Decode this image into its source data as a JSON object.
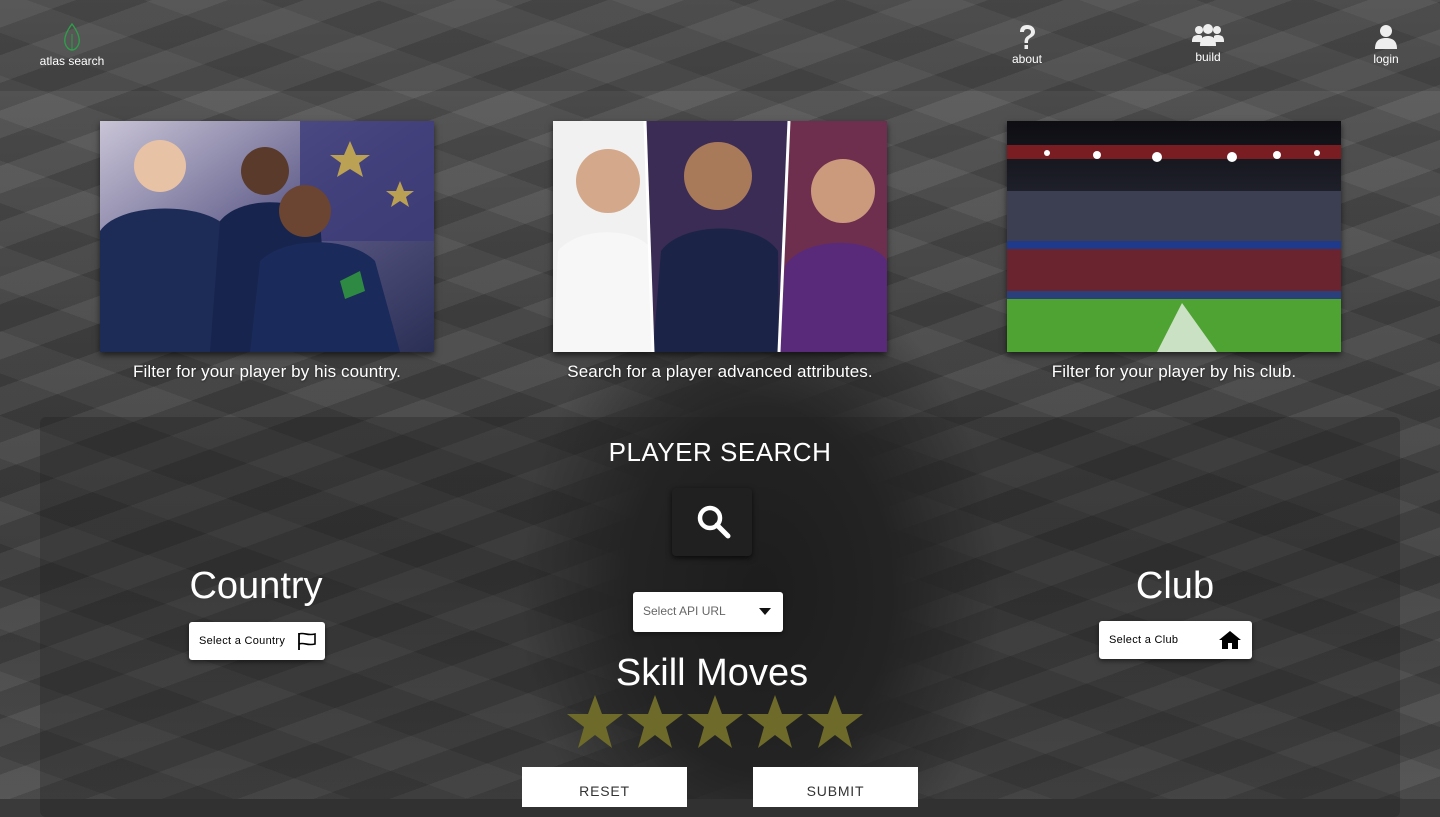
{
  "header": {
    "brand": "atlas search",
    "nav": [
      {
        "label": "about",
        "icon": "question-icon"
      },
      {
        "label": "build",
        "icon": "users-icon"
      },
      {
        "label": "login",
        "icon": "user-icon"
      }
    ]
  },
  "features": [
    {
      "caption": "Filter for your player by his country."
    },
    {
      "caption": "Search for a player advanced attributes."
    },
    {
      "caption": "Filter for your player by his club."
    }
  ],
  "search": {
    "title": "PLAYER SEARCH",
    "country": {
      "title": "Country",
      "placeholder": "Select a Country"
    },
    "api": {
      "placeholder": "Select API URL"
    },
    "club": {
      "title": "Club",
      "placeholder": "Select a Club"
    },
    "skill": {
      "title": "Skill Moves",
      "max_stars": 5
    },
    "reset_label": "RESET",
    "submit_label": "SUBMIT"
  },
  "colors": {
    "brand_leaf": "#2e9e4a",
    "star": "#6e6a2a"
  }
}
